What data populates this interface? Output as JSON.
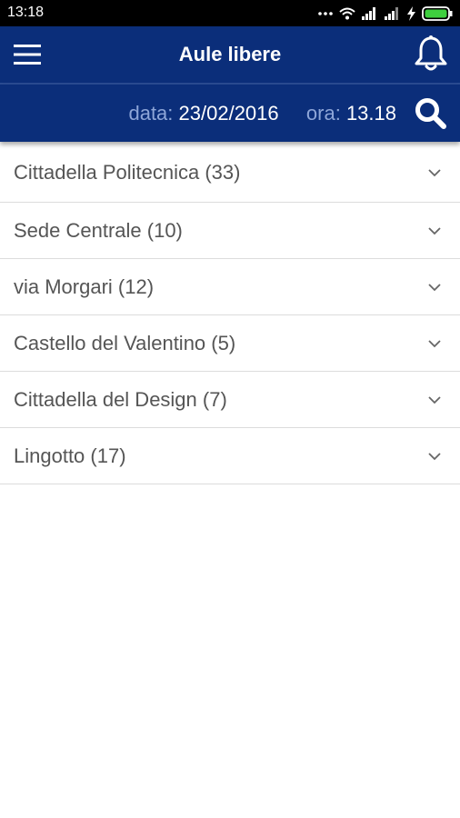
{
  "status_bar": {
    "time": "13:18",
    "icons": [
      "dots-icon",
      "wifi-icon",
      "signal-icon",
      "signal-icon",
      "charging-icon",
      "battery-icon"
    ]
  },
  "app_bar": {
    "title": "Aule libere",
    "menu_icon": "hamburger-menu-icon",
    "bell_icon": "bell-icon",
    "color": "#0b2e7a"
  },
  "filter": {
    "date_label": "data:",
    "date_value": "23/02/2016",
    "time_label": "ora:",
    "time_value": "13.18",
    "search_icon": "search-icon",
    "label_color": "#8ea6d8"
  },
  "campuses": [
    {
      "label": "Cittadella Politecnica (33)"
    },
    {
      "label": "Sede Centrale (10)"
    },
    {
      "label": "via Morgari (12)"
    },
    {
      "label": "Castello del Valentino (5)"
    },
    {
      "label": "Cittadella del Design (7)"
    },
    {
      "label": "Lingotto (17)"
    }
  ]
}
